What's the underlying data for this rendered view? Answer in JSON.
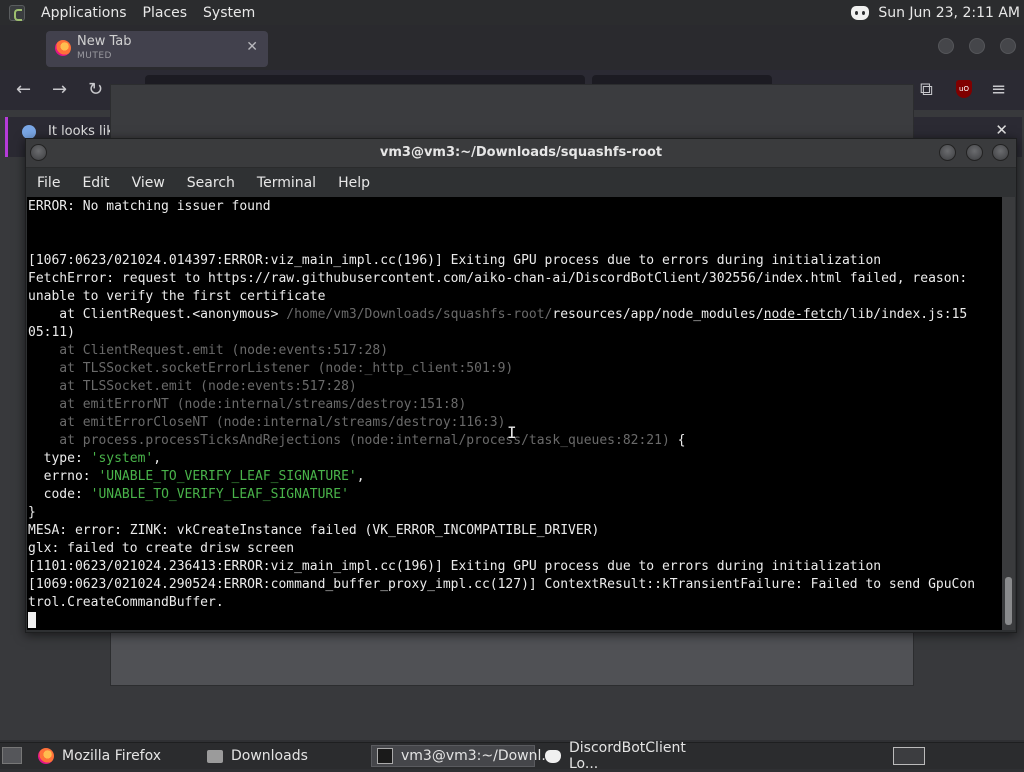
{
  "top_panel": {
    "menus": [
      "Applications",
      "Places",
      "System"
    ],
    "clock": "Sun Jun 23,  2:11 AM"
  },
  "firefox": {
    "tab_title": "New Tab",
    "tab_subtitle": "MUTED",
    "notification_text": "It looks like"
  },
  "terminal": {
    "title": "vm3@vm3:~/Downloads/squashfs-root",
    "menu": [
      "File",
      "Edit",
      "View",
      "Search",
      "Terminal",
      "Help"
    ],
    "lines": [
      "ERROR: No matching issuer found",
      "",
      "",
      "[1067:0623/021024.014397:ERROR:viz_main_impl.cc(196)] Exiting GPU process due to errors during initialization",
      "FetchError: request to https://raw.githubusercontent.com/aiko-chan-ai/DiscordBotClient/302556/index.html failed, reason:",
      "unable to verify the first certificate",
      "    at ClientRequest.<anonymous> ",
      "/home/vm3/Downloads/squashfs-root/",
      "resources/app/node_modules/",
      "node-fetch",
      "/lib/index.js:15",
      "05:11)",
      "    at ClientRequest.emit (node:events:517:28)",
      "    at TLSSocket.socketErrorListener (node:_http_client:501:9)",
      "    at TLSSocket.emit (node:events:517:28)",
      "    at emitErrorNT (node:internal/streams/destroy:151:8)",
      "    at emitErrorCloseNT (node:internal/streams/destroy:116:3)",
      "    at process.processTicksAndRejections (node:internal/process/task_queues:82:21)",
      " {",
      "  type: ",
      "'system'",
      ",",
      "  errno: ",
      "'UNABLE_TO_VERIFY_LEAF_SIGNATURE'",
      ",",
      "  code: ",
      "'UNABLE_TO_VERIFY_LEAF_SIGNATURE'",
      "}",
      "MESA: error: ZINK: vkCreateInstance failed (VK_ERROR_INCOMPATIBLE_DRIVER)",
      "glx: failed to create drisw screen",
      "[1101:0623/021024.236413:ERROR:viz_main_impl.cc(196)] Exiting GPU process due to errors during initialization",
      "[1069:0623/021024.290524:ERROR:command_buffer_proxy_impl.cc(127)] ContextResult::kTransientFailure: Failed to send GpuCon",
      "trol.CreateCommandBuffer."
    ]
  },
  "taskbar": {
    "tasks": [
      "Mozilla Firefox",
      "Downloads",
      "vm3@vm3:~/Downl...",
      "DiscordBotClient Lo..."
    ]
  }
}
